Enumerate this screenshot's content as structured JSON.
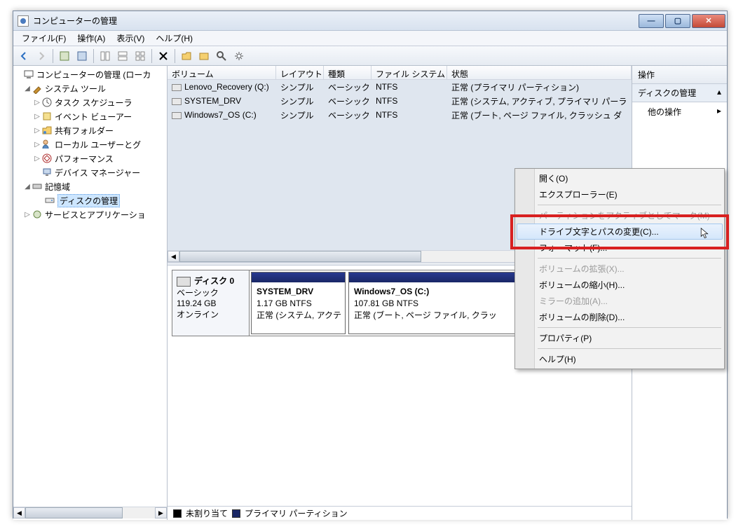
{
  "window": {
    "title": "コンピューターの管理"
  },
  "menu": {
    "file": "ファイル(F)",
    "action": "操作(A)",
    "view": "表示(V)",
    "help": "ヘルプ(H)"
  },
  "tree": {
    "root": "コンピューターの管理 (ローカ",
    "system_tools": "システム ツール",
    "task_scheduler": "タスク スケジューラ",
    "event_viewer": "イベント ビューアー",
    "shared_folders": "共有フォルダー",
    "local_users": "ローカル ユーザーとグ",
    "performance": "パフォーマンス",
    "device_manager": "デバイス マネージャー",
    "storage": "記憶域",
    "disk_management": "ディスクの管理",
    "services_apps": "サービスとアプリケーショ"
  },
  "vol_head": {
    "volume": "ボリューム",
    "layout": "レイアウト",
    "type": "種類",
    "fs": "ファイル システム",
    "status": "状態"
  },
  "volumes": [
    {
      "name": "Lenovo_Recovery (Q:)",
      "layout": "シンプル",
      "type": "ベーシック",
      "fs": "NTFS",
      "status": "正常 (プライマリ パーティション)"
    },
    {
      "name": "SYSTEM_DRV",
      "layout": "シンプル",
      "type": "ベーシック",
      "fs": "NTFS",
      "status": "正常 (システム, アクティブ, プライマリ パーラ"
    },
    {
      "name": "Windows7_OS  (C:)",
      "layout": "シンプル",
      "type": "ベーシック",
      "fs": "NTFS",
      "status": "正常 (ブート, ページ ファイル, クラッシュ ダ"
    }
  ],
  "disk": {
    "title": "ディスク 0",
    "type": "ベーシック",
    "size": "119.24 GB",
    "state": "オンライン",
    "parts": [
      {
        "name": "SYSTEM_DRV",
        "size": "1.17 GB NTFS",
        "status": "正常 (システム, アクテ"
      },
      {
        "name": "Windows7_OS  (C:)",
        "size": "107.81 GB NTFS",
        "status": "正常 (ブート, ページ ファイル, クラッ"
      }
    ]
  },
  "legend": {
    "unalloc": "未割り当て",
    "primary": "プライマリ パーティション"
  },
  "actions": {
    "head": "操作",
    "group": "ディスクの管理",
    "more": "他の操作"
  },
  "ctx": {
    "open": "開く(O)",
    "explorer": "エクスプローラー(E)",
    "mark_active": "パーティションをアクティブとしてマーク(M)",
    "change_letter": "ドライブ文字とパスの変更(C)...",
    "format": "フォーマット(F)...",
    "extend": "ボリュームの拡張(X)...",
    "shrink": "ボリュームの縮小(H)...",
    "mirror": "ミラーの追加(A)...",
    "delete": "ボリュームの削除(D)...",
    "properties": "プロパティ(P)",
    "help": "ヘルプ(H)"
  }
}
